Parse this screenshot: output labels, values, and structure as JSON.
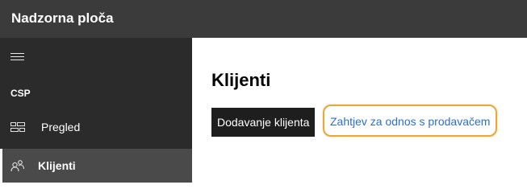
{
  "header": {
    "title": "Nadzorna ploča"
  },
  "sidebar": {
    "menu_icon": "hamburger-icon",
    "section_label": "CSP",
    "items": [
      {
        "label": "Pregled",
        "icon": "dashboard-tiles-icon",
        "selected": false
      },
      {
        "label": "Klijenti",
        "icon": "people-icon",
        "selected": true
      }
    ]
  },
  "main": {
    "title": "Klijenti",
    "add_client_label": "Dodavanje klijenta",
    "reseller_request_label": "Zahtjev za odnos s prodavačem",
    "highlight_color": "#e8a93a",
    "link_color": "#2d6fc7"
  }
}
